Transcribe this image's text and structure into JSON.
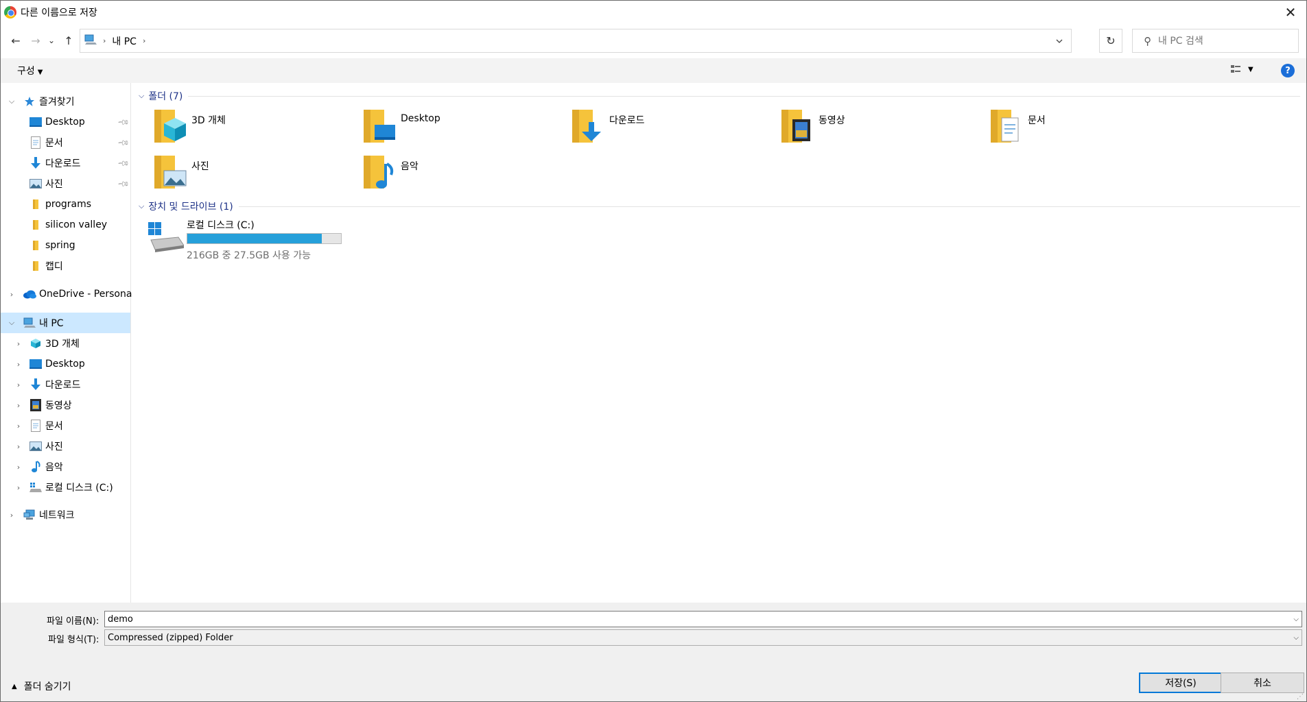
{
  "window": {
    "title": "다른 이름으로 저장",
    "close_glyph": "✕"
  },
  "nav": {
    "back": "←",
    "forward": "→",
    "recent": "⌄",
    "up": "↑",
    "breadcrumb_sep": "›",
    "breadcrumb": [
      "내 PC"
    ],
    "refresh": "↻",
    "search_placeholder": "내 PC 검색"
  },
  "toolbar": {
    "organize_label": "구성",
    "help_label": "?"
  },
  "sidebar": {
    "quick_access": {
      "label": "즐겨찾기",
      "items": [
        {
          "label": "Desktop",
          "icon": "desktop-icon",
          "pinned": true
        },
        {
          "label": "문서",
          "icon": "documents-icon",
          "pinned": true
        },
        {
          "label": "다운로드",
          "icon": "downloads-icon",
          "pinned": true
        },
        {
          "label": "사진",
          "icon": "pictures-icon",
          "pinned": true
        },
        {
          "label": "programs",
          "icon": "folder-icon",
          "pinned": false
        },
        {
          "label": "silicon valley",
          "icon": "folder-icon",
          "pinned": false
        },
        {
          "label": "spring",
          "icon": "folder-icon",
          "pinned": false
        },
        {
          "label": "캡디",
          "icon": "folder-icon",
          "pinned": false
        }
      ]
    },
    "onedrive": {
      "label": "OneDrive - Personal"
    },
    "this_pc": {
      "label": "내 PC",
      "items": [
        {
          "label": "3D 개체"
        },
        {
          "label": "Desktop"
        },
        {
          "label": "다운로드"
        },
        {
          "label": "동영상"
        },
        {
          "label": "문서"
        },
        {
          "label": "사진"
        },
        {
          "label": "음악"
        },
        {
          "label": "로컬 디스크 (C:)"
        }
      ]
    },
    "network": {
      "label": "네트워크"
    }
  },
  "main": {
    "folders_header": "폴더 (7)",
    "folders": [
      {
        "label": "3D 개체"
      },
      {
        "label": "Desktop"
      },
      {
        "label": "다운로드"
      },
      {
        "label": "동영상"
      },
      {
        "label": "문서"
      },
      {
        "label": "사진"
      },
      {
        "label": "음악"
      }
    ],
    "drives_header": "장치 및 드라이브 (1)",
    "drive": {
      "label": "로컬 디스크 (C:)",
      "free_text": "216GB 중 27.5GB 사용 가능",
      "used_fraction": 0.873
    }
  },
  "bottom": {
    "filename_label": "파일 이름(N):",
    "filename_value": "demo",
    "filetype_label": "파일 형식(T):",
    "filetype_value": "Compressed (zipped) Folder",
    "hide_folders_label": "폴더 숨기기",
    "save_label": "저장(S)",
    "cancel_label": "취소"
  },
  "colors": {
    "accent": "#0078d7",
    "selected_bg": "#cce8ff",
    "drive_bar": "#26a0da",
    "group_header": "#1e3287"
  }
}
